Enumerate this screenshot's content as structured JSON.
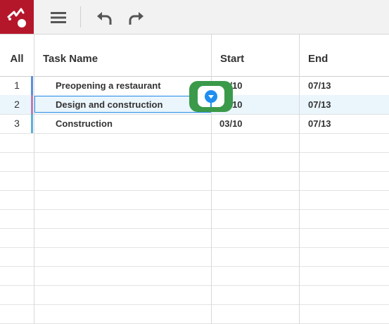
{
  "toolbar": {
    "logo_icon": "app-logo-icon",
    "menu_icon": "hamburger-menu-icon",
    "undo_icon": "undo-icon",
    "redo_icon": "redo-icon",
    "logo_color": "#b5172a"
  },
  "grid": {
    "columns": {
      "index": "All",
      "name": "Task Name",
      "start": "Start",
      "end": "End"
    },
    "rows": [
      {
        "index": "1",
        "name": "Preopening a restaurant",
        "start": "03/10",
        "end": "07/13",
        "bar_color": "#5b8fdc"
      },
      {
        "index": "2",
        "name": "Design and construction",
        "start": "03/10",
        "end": "07/13",
        "bar_color": "#b77fb6"
      },
      {
        "index": "3",
        "name": "Construction",
        "start": "03/10",
        "end": "07/13",
        "bar_color": "#5ab0d8"
      }
    ]
  },
  "accent_color": "#1f8ef0",
  "highlight_color": "#3a9a4a"
}
